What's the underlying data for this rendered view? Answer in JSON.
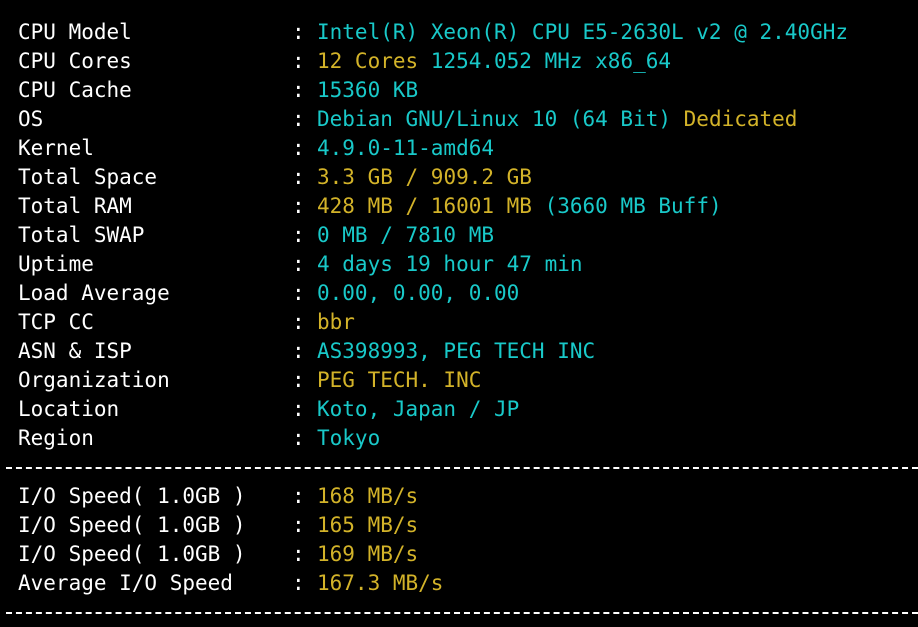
{
  "colors": {
    "background": "#000000",
    "label": "#ffffff",
    "cyan": "#19c9c9",
    "yellow": "#d3b329"
  },
  "separator": ":",
  "system_info": [
    {
      "label": "CPU Model",
      "parts": [
        {
          "text": "Intel(R) Xeon(R) CPU E5-2630L v2 @ 2.40GHz",
          "color": "cyan"
        }
      ]
    },
    {
      "label": "CPU Cores",
      "parts": [
        {
          "text": "12 Cores",
          "color": "yellow"
        },
        {
          "text": " 1254.052 MHz x86_64",
          "color": "cyan"
        }
      ]
    },
    {
      "label": "CPU Cache",
      "parts": [
        {
          "text": "15360 KB",
          "color": "cyan"
        }
      ]
    },
    {
      "label": "OS",
      "parts": [
        {
          "text": "Debian GNU/Linux 10 (64 Bit)",
          "color": "cyan"
        },
        {
          "text": " Dedicated",
          "color": "yellow"
        }
      ]
    },
    {
      "label": "Kernel",
      "parts": [
        {
          "text": "4.9.0-11-amd64",
          "color": "cyan"
        }
      ]
    },
    {
      "label": "Total Space",
      "parts": [
        {
          "text": "3.3 GB / ",
          "color": "yellow"
        },
        {
          "text": "909.2 GB",
          "color": "yellow"
        }
      ]
    },
    {
      "label": "Total RAM",
      "parts": [
        {
          "text": "428 MB / ",
          "color": "yellow"
        },
        {
          "text": "16001 MB",
          "color": "yellow"
        },
        {
          "text": " (3660 MB Buff)",
          "color": "cyan"
        }
      ]
    },
    {
      "label": "Total SWAP",
      "parts": [
        {
          "text": "0 MB / 7810 MB",
          "color": "cyan"
        }
      ]
    },
    {
      "label": "Uptime",
      "parts": [
        {
          "text": "4 days 19 hour 47 min",
          "color": "cyan"
        }
      ]
    },
    {
      "label": "Load Average",
      "parts": [
        {
          "text": "0.00, 0.00, 0.00",
          "color": "cyan"
        }
      ]
    },
    {
      "label": "TCP CC",
      "parts": [
        {
          "text": "bbr",
          "color": "yellow"
        }
      ]
    },
    {
      "label": "ASN & ISP",
      "parts": [
        {
          "text": "AS398993, PEG TECH INC",
          "color": "cyan"
        }
      ]
    },
    {
      "label": "Organization",
      "parts": [
        {
          "text": "PEG TECH. INC",
          "color": "yellow"
        }
      ]
    },
    {
      "label": "Location",
      "parts": [
        {
          "text": "Koto, Japan / JP",
          "color": "cyan"
        }
      ]
    },
    {
      "label": "Region",
      "parts": [
        {
          "text": "Tokyo",
          "color": "cyan"
        }
      ]
    }
  ],
  "io_info": [
    {
      "label": "I/O Speed( 1.0GB )",
      "parts": [
        {
          "text": "168 MB/s",
          "color": "yellow"
        }
      ]
    },
    {
      "label": "I/O Speed( 1.0GB )",
      "parts": [
        {
          "text": "165 MB/s",
          "color": "yellow"
        }
      ]
    },
    {
      "label": "I/O Speed( 1.0GB )",
      "parts": [
        {
          "text": "169 MB/s",
          "color": "yellow"
        }
      ]
    },
    {
      "label": "Average I/O Speed",
      "parts": [
        {
          "text": "167.3 MB/s",
          "color": "yellow"
        }
      ]
    }
  ]
}
